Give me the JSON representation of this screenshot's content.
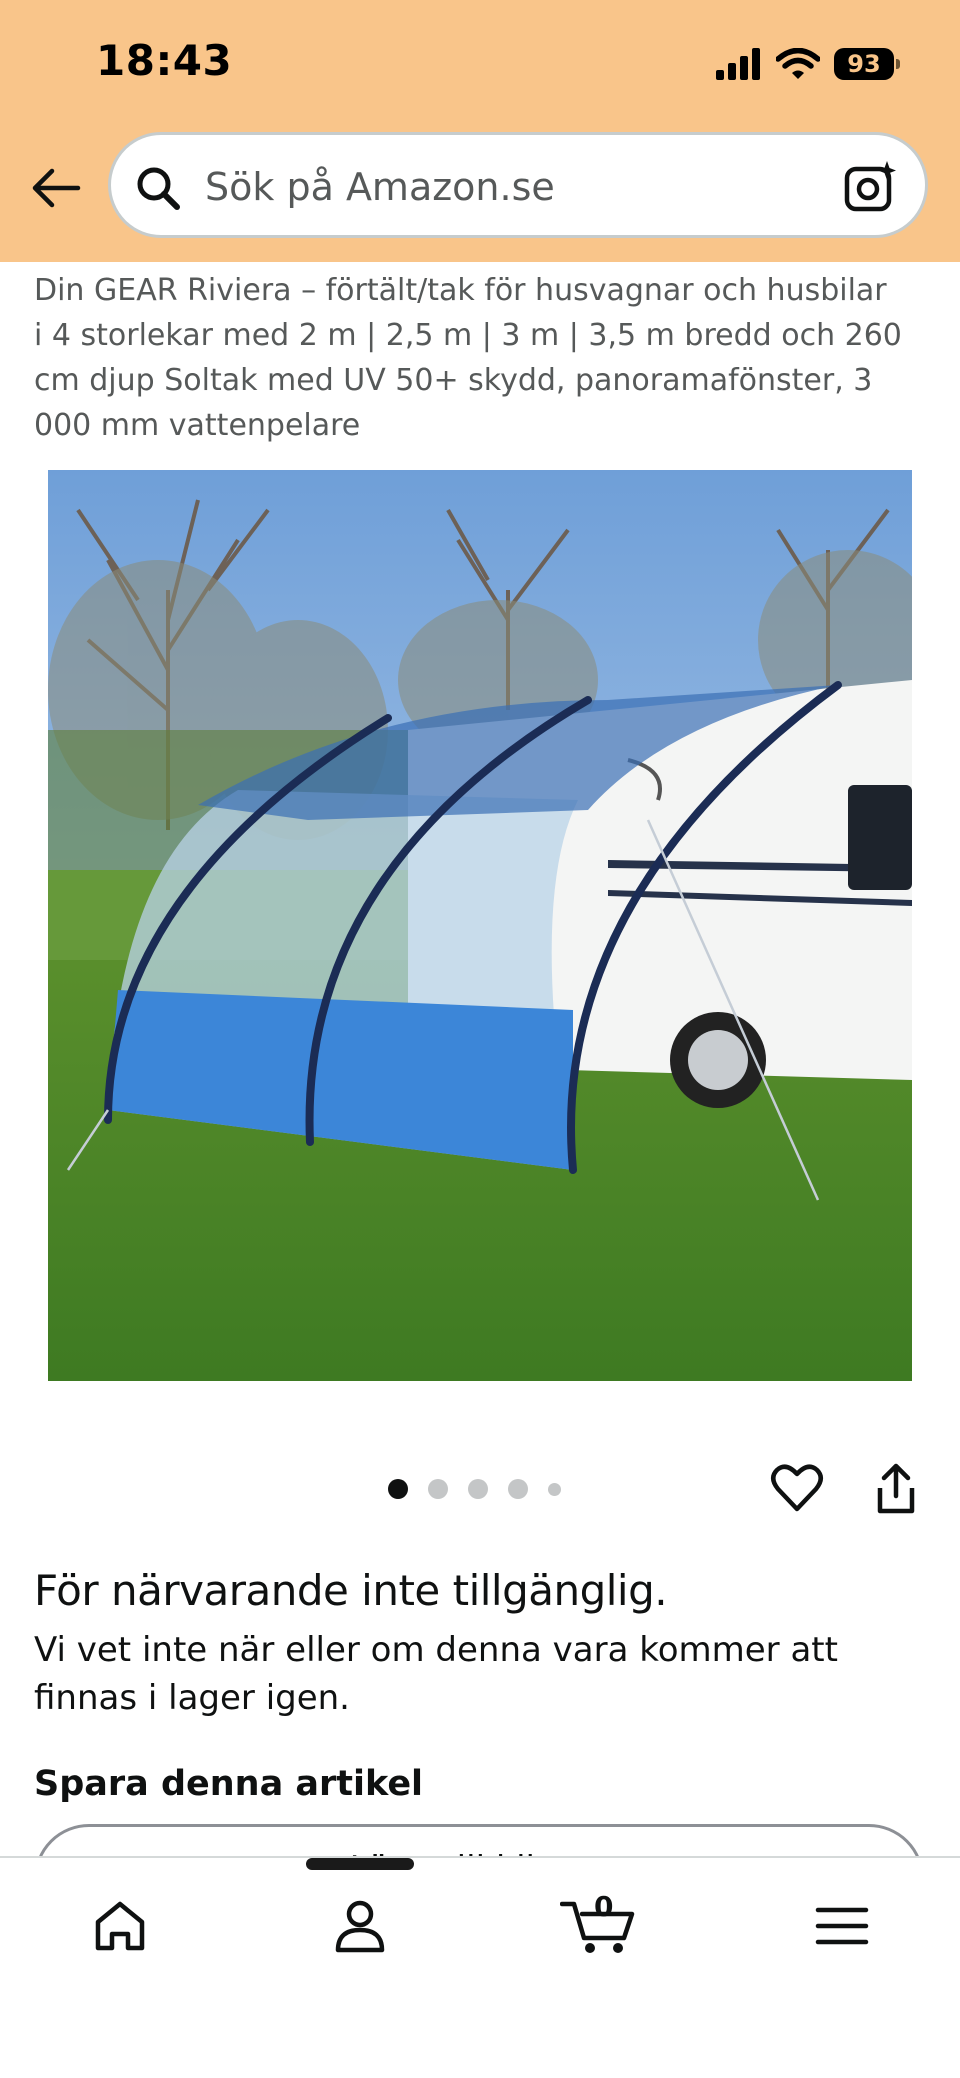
{
  "status_bar": {
    "time": "18:43",
    "battery": "93"
  },
  "search": {
    "placeholder": "Sök på Amazon.se"
  },
  "product": {
    "title": "Din GEAR Riviera – förtält/tak för husvagnar och husbilar i 4 storlekar med 2 m | 2,5 m | 3 m | 3,5 m bredd och 260 cm djup Soltak med UV 50+ skydd, panoramafönster, 3 000 mm vattenpelare",
    "image_count": 5,
    "active_image": 1,
    "availability": "För närvarande inte tillgänglig.",
    "availability_note": "Vi vet inte när eller om denna vara kommer att finnas i lager igen."
  },
  "save": {
    "heading": "Spara denna artikel",
    "add_to_list_label": "Lägg till i listan"
  },
  "nav": {
    "cart_count": "0"
  },
  "colors": {
    "header_bg": "#f9c58a",
    "awning_blue": "#3b82d6",
    "text": "#0f1111"
  },
  "icons": [
    "back-arrow-icon",
    "search-icon",
    "camera-icon",
    "heart-icon",
    "share-icon",
    "home-icon",
    "account-icon",
    "cart-icon",
    "menu-icon"
  ]
}
